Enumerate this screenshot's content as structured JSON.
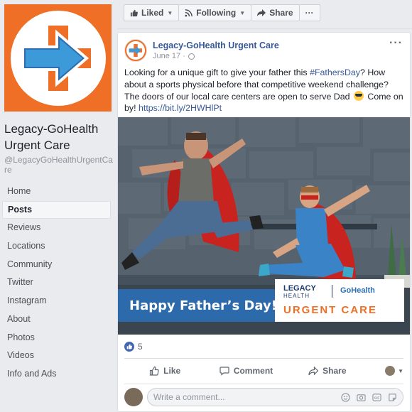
{
  "page": {
    "name": "Legacy-GoHealth Urgent Care",
    "handle": "@LegacyGoHealthUrgentCare"
  },
  "nav": {
    "items": [
      {
        "label": "Home"
      },
      {
        "label": "Posts"
      },
      {
        "label": "Reviews"
      },
      {
        "label": "Locations"
      },
      {
        "label": "Community"
      },
      {
        "label": "Twitter"
      },
      {
        "label": "Instagram"
      },
      {
        "label": "About"
      },
      {
        "label": "Photos"
      },
      {
        "label": "Videos"
      },
      {
        "label": "Info and Ads"
      }
    ],
    "active": "Posts"
  },
  "action_bar": {
    "liked": "Liked",
    "following": "Following",
    "share": "Share",
    "more": "···"
  },
  "post": {
    "author": "Legacy-GoHealth Urgent Care",
    "date": "June 17 ·",
    "text_1": "Looking for a unique gift to give your father this ",
    "hashtag": "#FathersDay",
    "text_2": "? How about a sports physical before that competitive weekend challenge? The doors of our local care centers are open to serve Dad ",
    "text_3": " Come on by! ",
    "link": "https://bit.ly/2HWHlPt",
    "image": {
      "caption": "Happy Father’s Day!",
      "brand_legacy": "LEGACY",
      "brand_health": "HEALTH",
      "brand_go": "Go",
      "brand_gohealth": "Health",
      "brand_urgent": "URGENT CARE"
    },
    "reaction_count": "5",
    "actions": {
      "like": "Like",
      "comment": "Comment",
      "share": "Share"
    },
    "comment_placeholder": "Write a comment..."
  },
  "colors": {
    "brand_orange": "#ee6f25",
    "brand_blue": "#2d6eb3",
    "link_blue": "#365899"
  }
}
